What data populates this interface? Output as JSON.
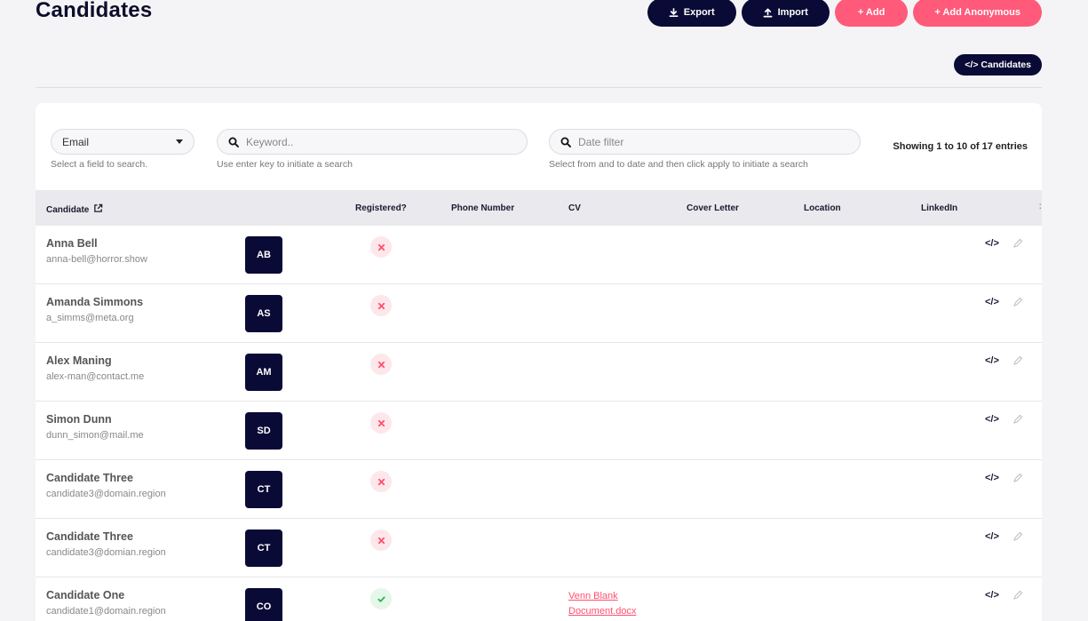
{
  "header": {
    "title": "Candidates",
    "actions": {
      "export_label": "Export",
      "import_label": "Import",
      "add_label": "+ Add",
      "add_anon_label": "+ Add Anonymous"
    },
    "code_pill_label": "</> Candidates"
  },
  "filters": {
    "field_select": {
      "value": "Email",
      "hint": "Select a field to search."
    },
    "keyword": {
      "placeholder": "Keyword..",
      "hint": "Use enter key to initiate a search"
    },
    "date": {
      "placeholder": "Date filter",
      "hint": "Select from and to date and then click apply to initiate a search"
    },
    "entries_text": "Showing 1 to 10 of 17 entries"
  },
  "table": {
    "columns": {
      "candidate": "Candidate",
      "registered": "Registered?",
      "phone": "Phone Number",
      "cv": "CV",
      "cover": "Cover Letter",
      "location": "Location",
      "linkedin": "LinkedIn",
      "more": ":"
    },
    "rows": [
      {
        "name": "Anna Bell",
        "email": "anna-bell@horror.show",
        "initials": "AB",
        "registered": false,
        "cv": ""
      },
      {
        "name": "Amanda Simmons",
        "email": "a_simms@meta.org",
        "initials": "AS",
        "registered": false,
        "cv": ""
      },
      {
        "name": "Alex Maning",
        "email": "alex-man@contact.me",
        "initials": "AM",
        "registered": false,
        "cv": ""
      },
      {
        "name": "Simon Dunn",
        "email": "dunn_simon@mail.me",
        "initials": "SD",
        "registered": false,
        "cv": ""
      },
      {
        "name": "Candidate Three",
        "email": "candidate3@domain.region",
        "initials": "CT",
        "registered": false,
        "cv": ""
      },
      {
        "name": "Candidate Three",
        "email": "candidate3@domian.region",
        "initials": "CT",
        "registered": false,
        "cv": ""
      },
      {
        "name": "Candidate One",
        "email": "candidate1@domain.region",
        "initials": "CO",
        "registered": true,
        "cv": "Venn Blank Document.docx"
      }
    ],
    "row_code_label": "</>"
  },
  "colors": {
    "navy": "#0a0a36",
    "pink": "#ff5a7a",
    "red_x": "#ff4f6e",
    "green_check": "#22b14c"
  }
}
